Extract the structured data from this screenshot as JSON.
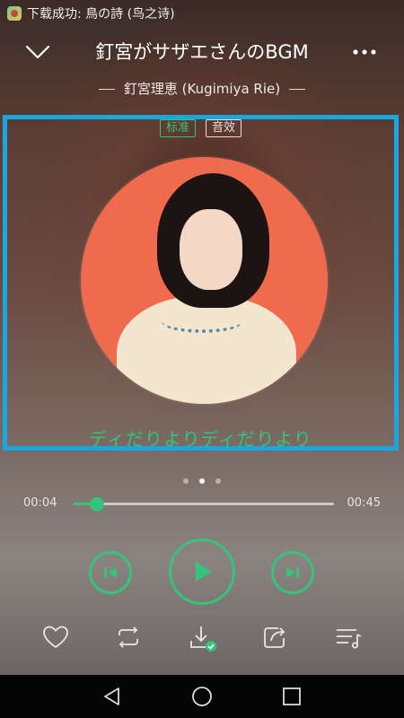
{
  "status_bar": {
    "notification": "下载成功: 鳥の詩 (鸟之诗)"
  },
  "header": {
    "title": "釘宮がサザエさんのBGM",
    "artist": "釘宮理恵 (Kugimiya Rie)",
    "collapse_icon": "chevron-down-icon",
    "more_icon": "more-horizontal-icon"
  },
  "quality": {
    "standard": "标准",
    "effect": "音效"
  },
  "lyric": {
    "current_line": "ディだりよりディだりより"
  },
  "pager": {
    "count": 3,
    "active_index": 1
  },
  "progress": {
    "current_time": "00:04",
    "total_time": "00:45",
    "fraction": 0.09
  },
  "controls": {
    "prev_icon": "skip-previous-icon",
    "play_icon": "play-icon",
    "next_icon": "skip-next-icon"
  },
  "actions": [
    "heart-icon",
    "repeat-icon",
    "download-done-icon",
    "share-icon",
    "playlist-icon"
  ],
  "colors": {
    "accent": "#35c47a",
    "highlight_border": "#1aa7e0"
  }
}
